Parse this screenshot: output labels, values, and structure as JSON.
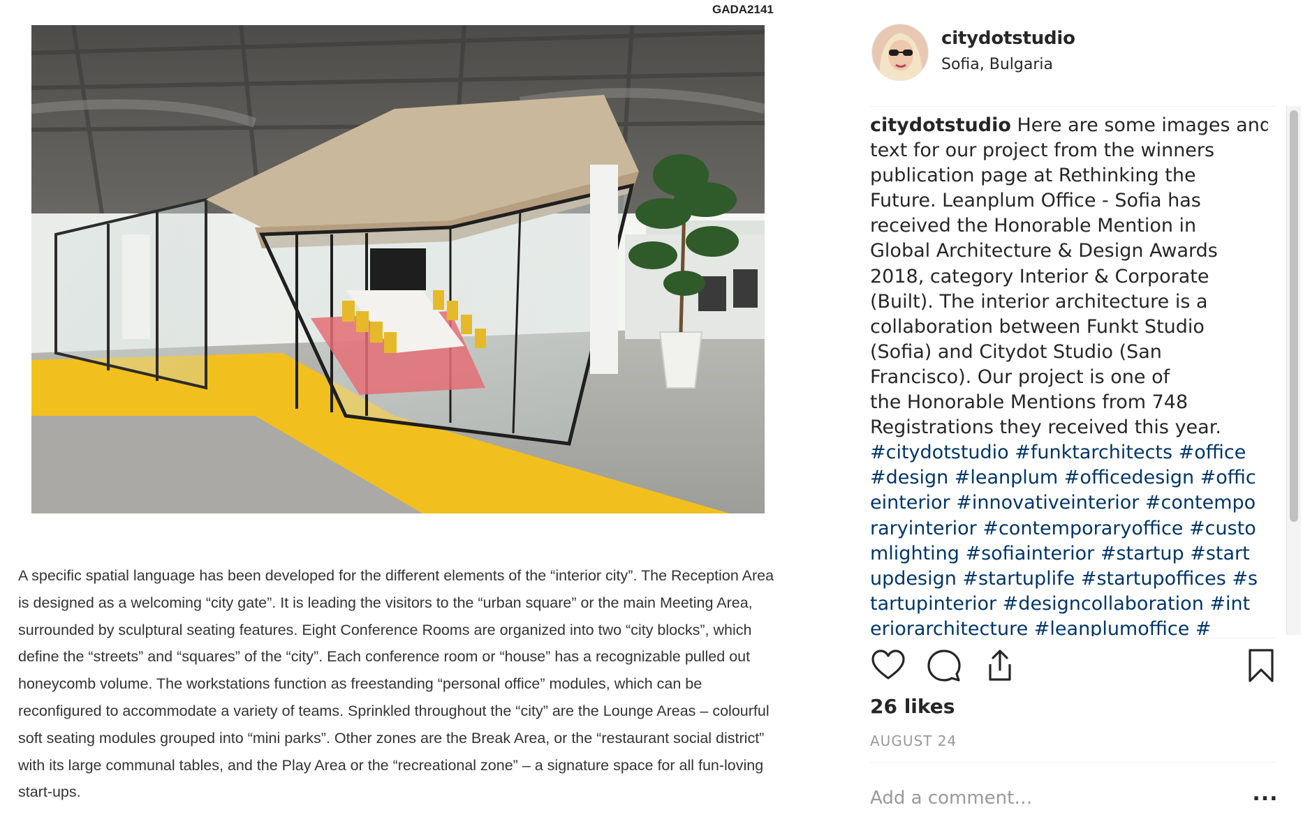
{
  "post_image": {
    "page_code": "GADA2141",
    "article_lines": [
      "A specific spatial language has been developed for the different elements of the “interior city”. The Reception Area",
      "is designed as a welcoming “city gate”. It is leading the visitors to the “urban square” or the main Meeting Area,",
      "surrounded by sculptural seating features. Eight Conference Rooms are organized into two “city blocks”, which",
      "define the “streets” and “squares” of the “city”. Each conference room or “house” has a recognizable pulled out",
      "honeycomb volume. The workstations function as freestanding “personal office” modules, which can be",
      "reconfigured to accommodate a variety of teams. Sprinkled throughout the “city” are the Lounge Areas – colourful",
      "soft seating modules grouped into “mini parks”.  Other zones are the Break Area, or the “restaurant social district”",
      "with its large communal tables, and the Play Area or the “recreational zone” – a signature space for all fun-loving",
      "start-ups."
    ],
    "colors": {
      "floor_yellow": "#f2c01e",
      "ceiling": "#5a5a58",
      "carpet_grey": "#a8a8a4"
    }
  },
  "header": {
    "username": "citydotstudio",
    "location": "Sofia, Bulgaria",
    "avatar_icon": "profile-photo"
  },
  "caption": {
    "user": "citydotstudio",
    "text_lines": [
      " Here are some images and",
      "text for our project from the winners",
      "publication page at Rethinking the",
      "Future. Leanplum Office - Sofia has",
      "received the Honorable Mention in",
      "Global Architecture & Design Awards",
      "2018, category Interior & Corporate",
      "(Built). The interior architecture is a",
      "collaboration between Funkt Studio",
      "(Sofia) and Citydot Studio (San",
      "Francisco). Our project is one of",
      "the Honorable Mentions from 748",
      "Registrations they received this year."
    ],
    "hashtag_lines": [
      "#citydotstudio #funktarchitects #office",
      "#design #leanplum #officedesign #offic",
      "einterior #innovativeinterior #contempo",
      "raryinterior #contemporaryoffice #custo",
      "mlighting #sofiainterior #startup #start",
      "updesign #startuplife #startupoffices #s",
      "tartupinterior #designcollaboration #int",
      "eriorarchitecture #leanplumoffice #"
    ]
  },
  "actions": {
    "like_icon": "heart-icon",
    "comment_icon": "comment-icon",
    "share_icon": "share-icon",
    "save_icon": "bookmark-icon"
  },
  "likes": "26 likes",
  "date": "AUGUST 24",
  "comment": {
    "placeholder": "Add a comment…",
    "more_label": "..."
  },
  "colors": {
    "hashtag": "#003569",
    "text": "#262626",
    "muted": "#999999",
    "divider": "#efefef"
  }
}
